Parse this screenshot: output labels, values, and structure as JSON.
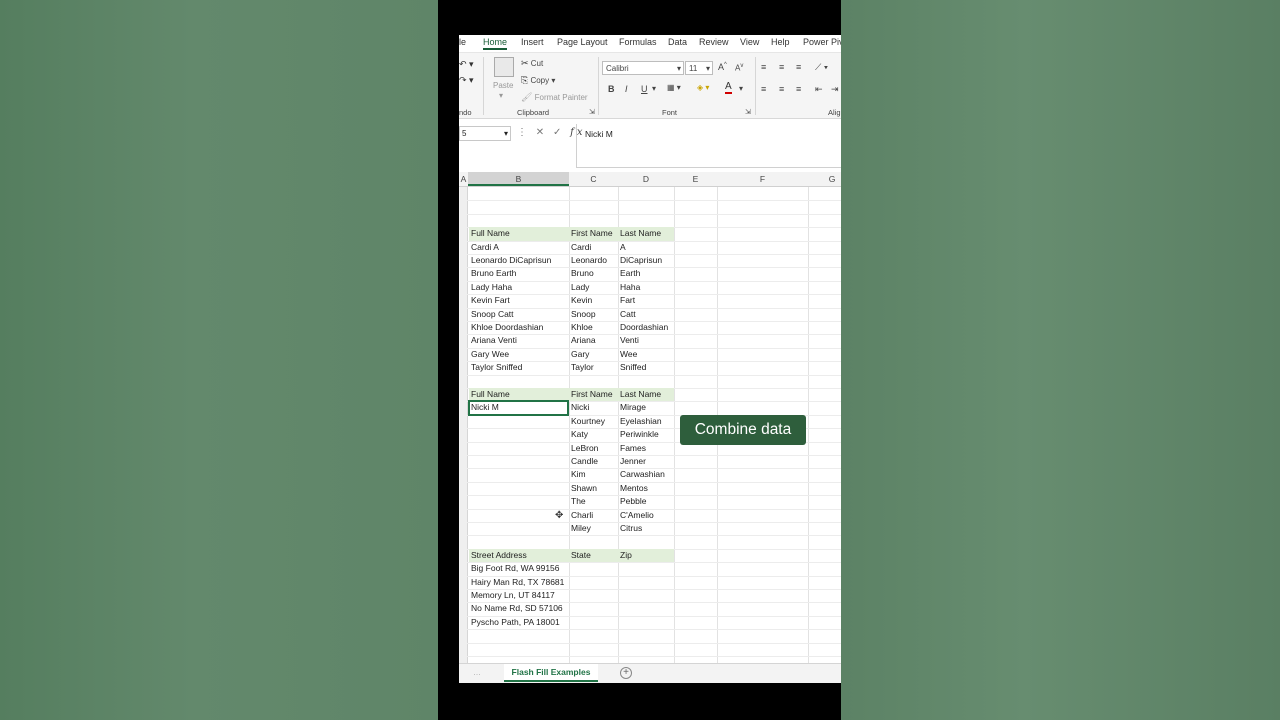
{
  "ribbon": {
    "tabs": [
      "le",
      "Home",
      "Insert",
      "Page Layout",
      "Formulas",
      "Data",
      "Review",
      "View",
      "Help",
      "Power Pivo"
    ],
    "active_tab": "Home",
    "clipboard": {
      "paste": "Paste",
      "cut": "Cut",
      "copy": "Copy",
      "format_painter": "Format Painter",
      "label": "Clipboard"
    },
    "font": {
      "name": "Calibri",
      "size": "11",
      "bold": "B",
      "italic": "I",
      "underline": "U",
      "label": "Font"
    },
    "undo_label": "ndo",
    "align_label": "Alig"
  },
  "formula_bar": {
    "name_box": "5",
    "value": "Nicki M"
  },
  "columns": [
    "A",
    "B",
    "C",
    "D",
    "E",
    "F",
    "G"
  ],
  "table1": {
    "headers": [
      "Full Name",
      "First Name",
      "Last Name"
    ],
    "rows": [
      [
        "Cardi A",
        "Cardi",
        "A"
      ],
      [
        "Leonardo DiCaprisun",
        "Leonardo",
        "DiCaprisun"
      ],
      [
        "Bruno Earth",
        "Bruno",
        "Earth"
      ],
      [
        "Lady Haha",
        "Lady",
        "Haha"
      ],
      [
        "Kevin Fart",
        "Kevin",
        "Fart"
      ],
      [
        "Snoop Catt",
        "Snoop",
        "Catt"
      ],
      [
        "Khloe Doordashian",
        "Khloe",
        "Doordashian"
      ],
      [
        "Ariana Venti",
        "Ariana",
        "Venti"
      ],
      [
        "Gary Wee",
        "Gary",
        "Wee"
      ],
      [
        "Taylor Sniffed",
        "Taylor",
        "Sniffed"
      ]
    ]
  },
  "table2": {
    "headers": [
      "Full Name",
      "First Name",
      "Last Name"
    ],
    "rows": [
      [
        "Nicki M",
        "Nicki",
        "Mirage"
      ],
      [
        "",
        "Kourtney",
        "Eyelashian"
      ],
      [
        "",
        "Katy",
        "Periwinkle"
      ],
      [
        "",
        "LeBron",
        "Fames"
      ],
      [
        "",
        "Candle",
        "Jenner"
      ],
      [
        "",
        "Kim",
        "Carwashian"
      ],
      [
        "",
        "Shawn",
        "Mentos"
      ],
      [
        "",
        "The",
        "Pebble"
      ],
      [
        "",
        "Charli",
        "C'Amelio"
      ],
      [
        "",
        "Miley",
        "Citrus"
      ]
    ]
  },
  "table3": {
    "headers": [
      "Street Address",
      "State",
      "Zip"
    ],
    "rows": [
      [
        "Big Foot Rd, WA 99156",
        "",
        ""
      ],
      [
        "Hairy Man Rd, TX 78681",
        "",
        ""
      ],
      [
        "Memory Ln, UT 84117",
        "",
        ""
      ],
      [
        "No Name Rd, SD 57106",
        "",
        ""
      ],
      [
        "Pyscho Path, PA 18001",
        "",
        ""
      ]
    ]
  },
  "overlay_caption": "Combine data",
  "sheet_tab": "Flash Fill Examples",
  "colors": {
    "accent": "#217346",
    "header_fill": "#e2efda",
    "caption_bg": "#2e5e3c"
  }
}
